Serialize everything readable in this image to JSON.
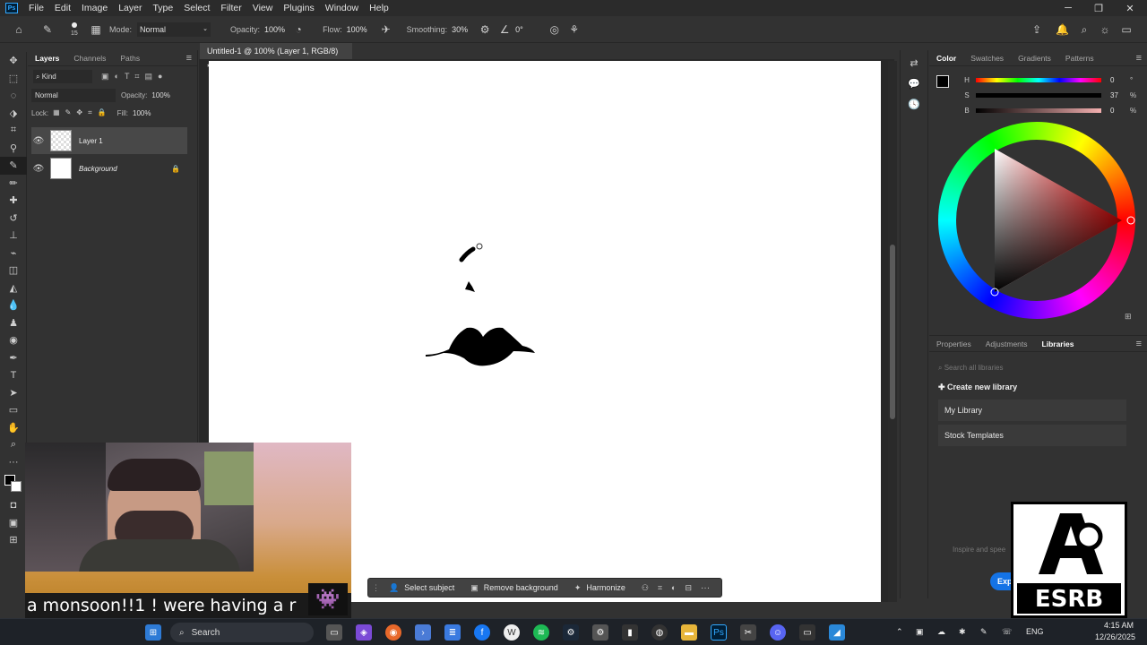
{
  "menubar": {
    "logo": "Ps",
    "items": [
      "File",
      "Edit",
      "Image",
      "Layer",
      "Type",
      "Select",
      "Filter",
      "View",
      "Plugins",
      "Window",
      "Help"
    ]
  },
  "options": {
    "brush_size": "15",
    "mode_label": "Mode:",
    "mode_value": "Normal",
    "opacity_label": "Opacity:",
    "opacity_value": "100%",
    "flow_label": "Flow:",
    "flow_value": "100%",
    "smoothing_label": "Smoothing:",
    "smoothing_value": "30%",
    "angle_value": "0°"
  },
  "layers_panel": {
    "tabs": [
      "Layers",
      "Channels",
      "Paths"
    ],
    "filter_label": "Kind",
    "blend_mode": "Normal",
    "opacity_label": "Opacity:",
    "opacity_value": "100%",
    "lock_label": "Lock:",
    "fill_label": "Fill:",
    "fill_value": "100%",
    "layers": [
      {
        "name": "Layer 1"
      },
      {
        "name": "Background"
      }
    ]
  },
  "document": {
    "tab_title": "Untitled-1 @ 100% (Layer 1, RGB/8) *"
  },
  "color_panel": {
    "tabs": [
      "Color",
      "Swatches",
      "Gradients",
      "Patterns"
    ],
    "sliders": [
      {
        "letter": "H",
        "value": "0"
      },
      {
        "letter": "S",
        "value": "37"
      },
      {
        "letter": "B",
        "value": "0"
      }
    ],
    "pct": "%",
    "foreground": "#000000",
    "background": "#ffffff"
  },
  "libraries_panel": {
    "tabs": [
      "Properties",
      "Adjustments",
      "Libraries"
    ],
    "search_placeholder": "Search all libraries",
    "create_label": "Create new library",
    "items": [
      "My Library",
      "Stock Templates"
    ],
    "faded_text": "Inspire and spee",
    "explore_label": "Exp"
  },
  "contextual_bar": {
    "buttons": [
      "Select subject",
      "Remove background",
      "Harmonize"
    ]
  },
  "webcam": {
    "ticker": "a monsoon!!1 !   were having a r"
  },
  "esrb": {
    "text": "ESRB"
  },
  "taskbar": {
    "search_label": "Search",
    "lang": "ENG",
    "time": "4:15 AM",
    "date": "12/26/2025"
  }
}
